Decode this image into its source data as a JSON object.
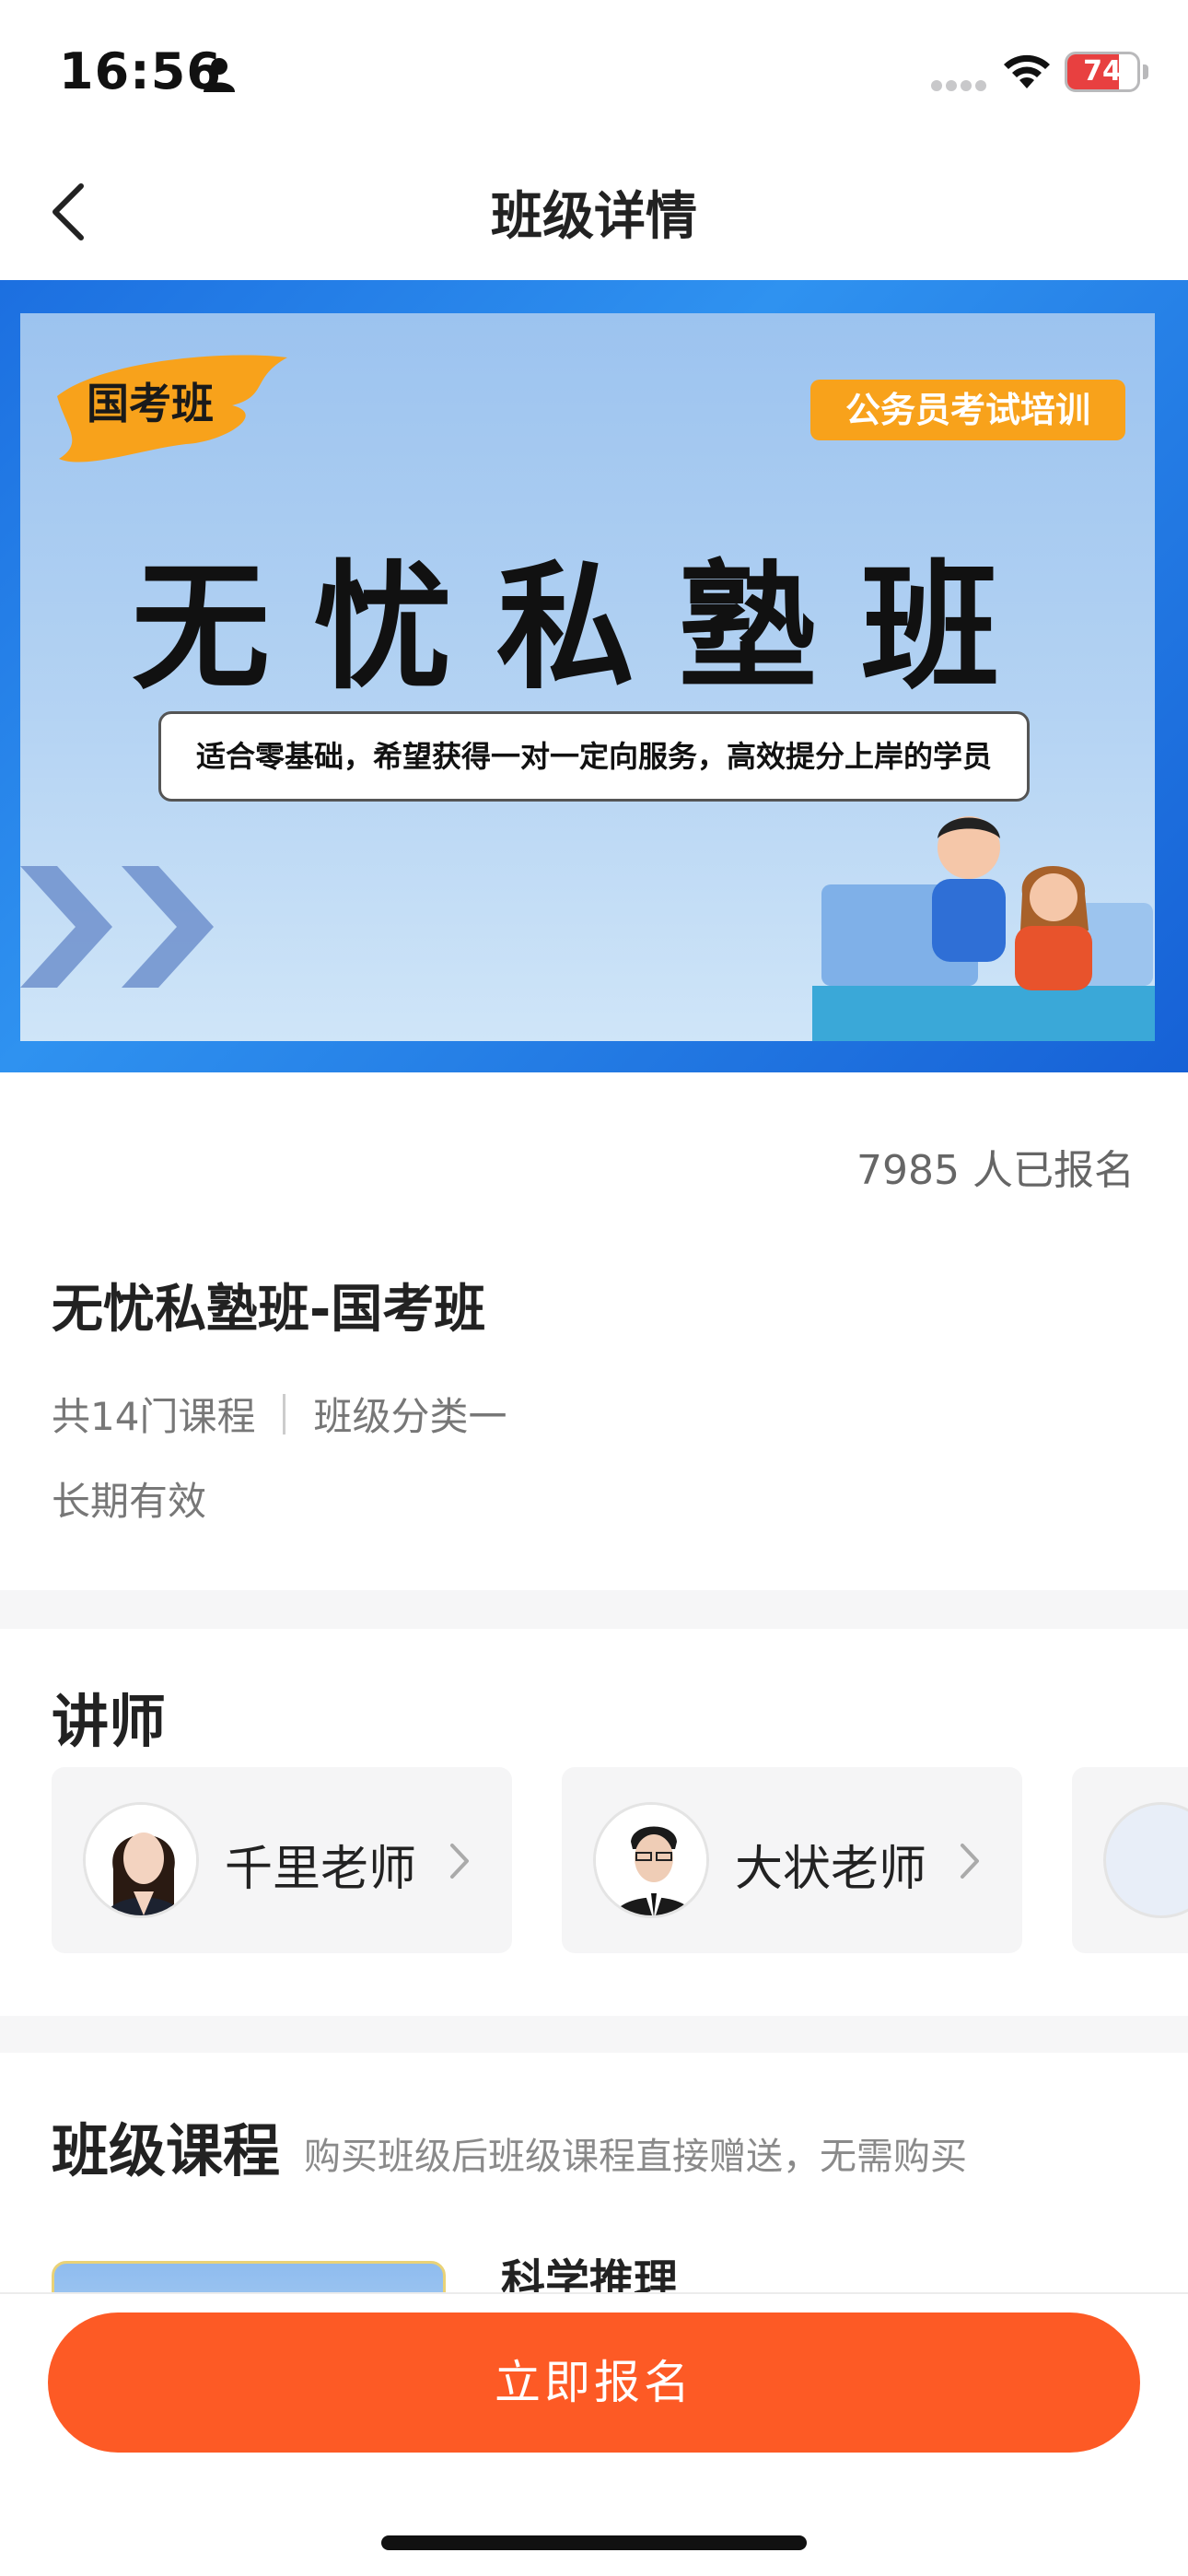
{
  "status_bar": {
    "time": "16:56",
    "battery": "74",
    "battery_level": 0.74,
    "icons": [
      "person-icon",
      "signal-dots-icon",
      "wifi-icon",
      "battery-icon"
    ]
  },
  "nav": {
    "title": "班级详情",
    "back_icon": "chevron-left-icon"
  },
  "banner": {
    "tag_left": "国考班",
    "tag_right": "公务员考试培训",
    "headline": "无忧私塾班",
    "subtitle": "适合零基础，希望获得一对一定向服务，高效提分上岸的学员"
  },
  "info": {
    "enrolled": "7985 人已报名",
    "title": "无忧私塾班-国考班",
    "course_count": "共14门课程",
    "category": "班级分类一",
    "validity": "长期有效"
  },
  "teachers": {
    "title": "讲师",
    "items": [
      {
        "name": "千里老师"
      },
      {
        "name": "大状老师"
      }
    ]
  },
  "courses": {
    "title": "班级课程",
    "note": "购买班级后班级课程直接赠送，无需购买",
    "items": [
      {
        "name": "科学推理"
      }
    ]
  },
  "footer": {
    "enroll_label": "立即报名"
  },
  "colors": {
    "accent": "#fd5a25",
    "banner_blue": "#1c6fe0",
    "tag_orange": "#f8a21b"
  }
}
